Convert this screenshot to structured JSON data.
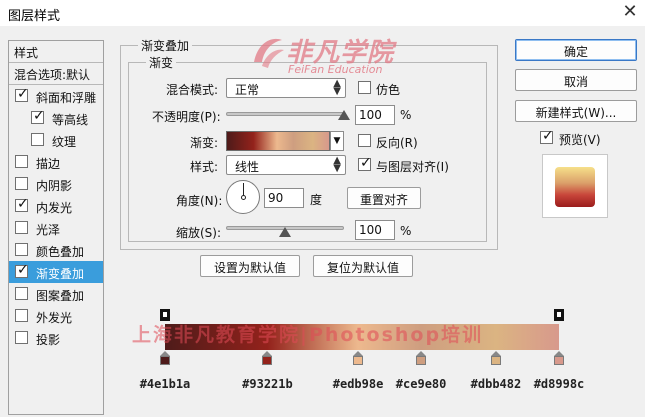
{
  "window": {
    "title": "图层样式",
    "close_glyph": "✕"
  },
  "sidebar": {
    "header": "样式",
    "blend_options": "混合选项:默认",
    "items": [
      {
        "label": "斜面和浮雕",
        "checked": true,
        "indent": false,
        "selected": false
      },
      {
        "label": "等高线",
        "checked": true,
        "indent": true,
        "selected": false
      },
      {
        "label": "纹理",
        "checked": false,
        "indent": true,
        "selected": false
      },
      {
        "label": "描边",
        "checked": false,
        "indent": false,
        "selected": false
      },
      {
        "label": "内阴影",
        "checked": false,
        "indent": false,
        "selected": false
      },
      {
        "label": "内发光",
        "checked": true,
        "indent": false,
        "selected": false
      },
      {
        "label": "光泽",
        "checked": false,
        "indent": false,
        "selected": false
      },
      {
        "label": "颜色叠加",
        "checked": false,
        "indent": false,
        "selected": false
      },
      {
        "label": "渐变叠加",
        "checked": true,
        "indent": false,
        "selected": true
      },
      {
        "label": "图案叠加",
        "checked": false,
        "indent": false,
        "selected": false
      },
      {
        "label": "外发光",
        "checked": false,
        "indent": false,
        "selected": false
      },
      {
        "label": "投影",
        "checked": false,
        "indent": false,
        "selected": false
      }
    ]
  },
  "panel": {
    "outer_title": "渐变叠加",
    "inner_title": "渐变",
    "blend_mode_label": "混合模式:",
    "blend_mode_value": "正常",
    "dither_label": "仿色",
    "dither_checked": false,
    "opacity_label": "不透明度(P):",
    "opacity_value": "100",
    "opacity_fraction": 1.0,
    "percent": "%",
    "gradient_label": "渐变:",
    "reverse_label": "反向(R)",
    "reverse_checked": false,
    "style_label": "样式:",
    "style_value": "线性",
    "align_label": "与图层对齐(I)",
    "align_checked": true,
    "angle_label": "角度(N):",
    "angle_value": "90",
    "degree": "度",
    "reset_align": "重置对齐",
    "scale_label": "缩放(S):",
    "scale_value": "100",
    "scale_fraction": 0.5,
    "set_default": "设置为默认值",
    "reset_default": "复位为默认值"
  },
  "buttons": {
    "ok": "确定",
    "cancel": "取消",
    "new_style": "新建样式(W)...",
    "preview_label": "预览(V)",
    "preview_checked": true
  },
  "watermark": {
    "brand": "非凡学院",
    "sub": "FeiFan Education",
    "overlay": "上海非凡教育学院|Photoshop培训"
  },
  "gradient": {
    "stops": [
      {
        "color": "#4e1b1a",
        "hex_label": "#4e1b1a",
        "position": 0.0
      },
      {
        "color": "#93221b",
        "hex_label": "#93221b",
        "position": 0.26
      },
      {
        "color": "#edb98e",
        "hex_label": "#edb98e",
        "position": 0.49
      },
      {
        "color": "#ce9e80",
        "hex_label": "#ce9e80",
        "position": 0.65
      },
      {
        "color": "#dbb482",
        "hex_label": "#dbb482",
        "position": 0.84
      },
      {
        "color": "#d8998c",
        "hex_label": "#d8998c",
        "position": 1.0
      }
    ],
    "opacity_stops": [
      0.0,
      1.0
    ]
  },
  "colors": {
    "accent": "#3a9ddc",
    "selected_text": "#ffffff"
  }
}
